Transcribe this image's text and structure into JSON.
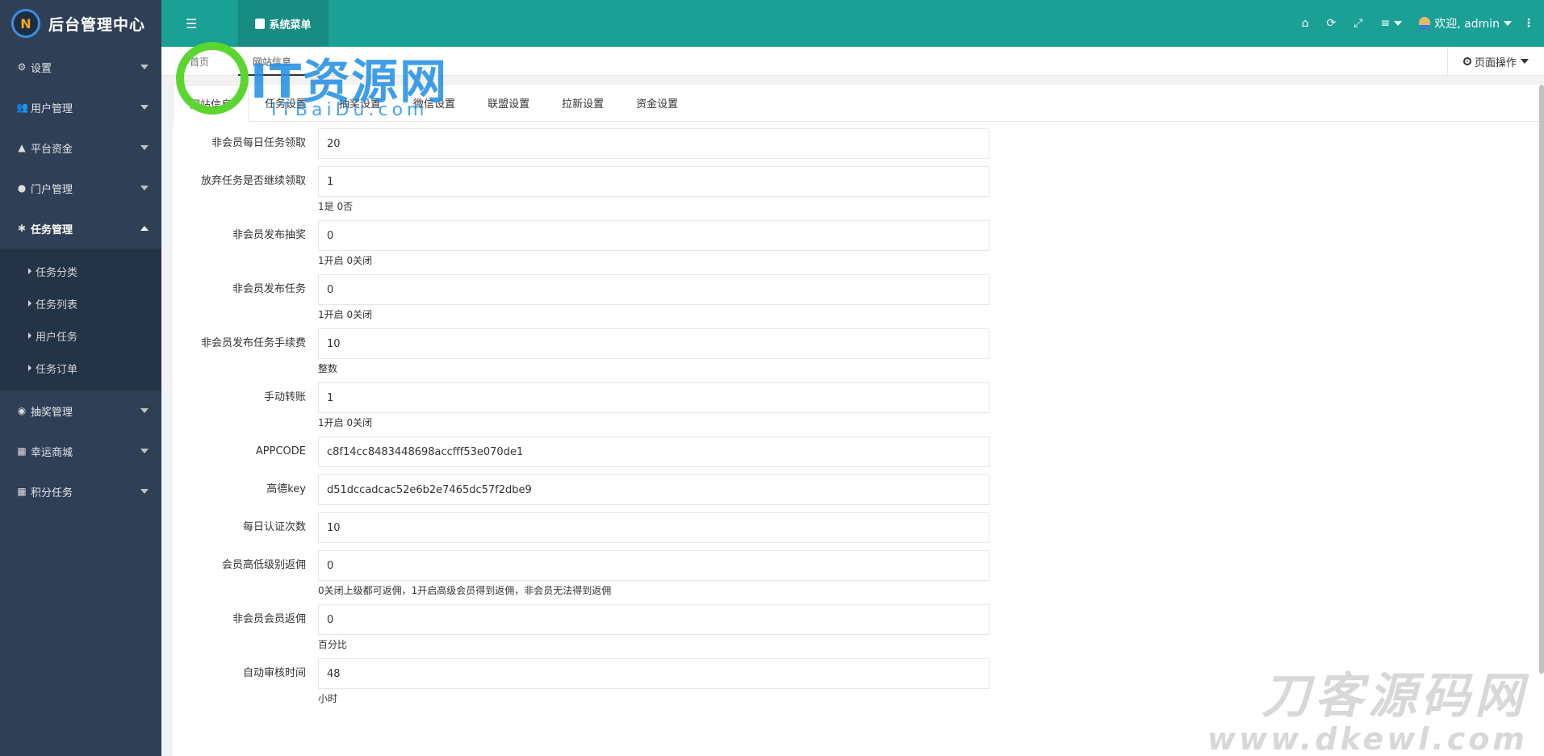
{
  "brand": {
    "title": "后台管理中心",
    "logo_text": "N"
  },
  "topbar": {
    "system_menu_label": "系统菜单",
    "welcome": "欢迎, admin"
  },
  "sidebar": {
    "items": [
      {
        "label": "设置",
        "icon": "gears-icon"
      },
      {
        "label": "用户管理",
        "icon": "users-icon"
      },
      {
        "label": "平台资金",
        "icon": "bank-icon"
      },
      {
        "label": "门户管理",
        "icon": "globe-icon"
      },
      {
        "label": "任务管理",
        "icon": "bug-icon"
      },
      {
        "label": "抽奖管理",
        "icon": "compass-icon"
      },
      {
        "label": "幸运商城",
        "icon": "building-icon"
      },
      {
        "label": "积分任务",
        "icon": "grid-icon"
      }
    ],
    "task_submenu": [
      "任务分类",
      "任务列表",
      "用户任务",
      "任务订单"
    ]
  },
  "breadcrumb": {
    "home": "首页",
    "current_tab": "网站信息"
  },
  "page_ops_label": "页面操作",
  "settings_tabs": [
    "网站信息",
    "任务设置",
    "抽奖设置",
    "微信设置",
    "联盟设置",
    "拉新设置",
    "资金设置"
  ],
  "form": [
    {
      "label": "非会员每日任务领取",
      "value": "20",
      "hint": ""
    },
    {
      "label": "放弃任务是否继续领取",
      "value": "1",
      "hint": "1是 0否"
    },
    {
      "label": "非会员发布抽奖",
      "value": "0",
      "hint": "1开启 0关闭"
    },
    {
      "label": "非会员发布任务",
      "value": "0",
      "hint": "1开启 0关闭"
    },
    {
      "label": "非会员发布任务手续费",
      "value": "10",
      "hint": "整数"
    },
    {
      "label": "手动转账",
      "value": "1",
      "hint": "1开启 0关闭"
    },
    {
      "label": "APPCODE",
      "value": "c8f14cc8483448698accfff53e070de1",
      "hint": ""
    },
    {
      "label": "高德key",
      "value": "d51dccadcac52e6b2e7465dc57f2dbe9",
      "hint": ""
    },
    {
      "label": "每日认证次数",
      "value": "10",
      "hint": ""
    },
    {
      "label": "会员高低级别返佣",
      "value": "0",
      "hint": "0关闭上级都可返佣，1开启高级会员得到返佣，非会员无法得到返佣"
    },
    {
      "label": "非会员会员返佣",
      "value": "0",
      "hint": "百分比"
    },
    {
      "label": "自动审核时间",
      "value": "48",
      "hint": "小时"
    }
  ],
  "watermarks": {
    "top": "IT资源网",
    "top_sub": "ITBaiDu.com",
    "bottom": "刀客源码网",
    "bottom_sub": "www.dkewl.com"
  },
  "colors": {
    "topbar": "#1aa094",
    "sidebar": "#2f4056",
    "submenu": "#243346"
  }
}
